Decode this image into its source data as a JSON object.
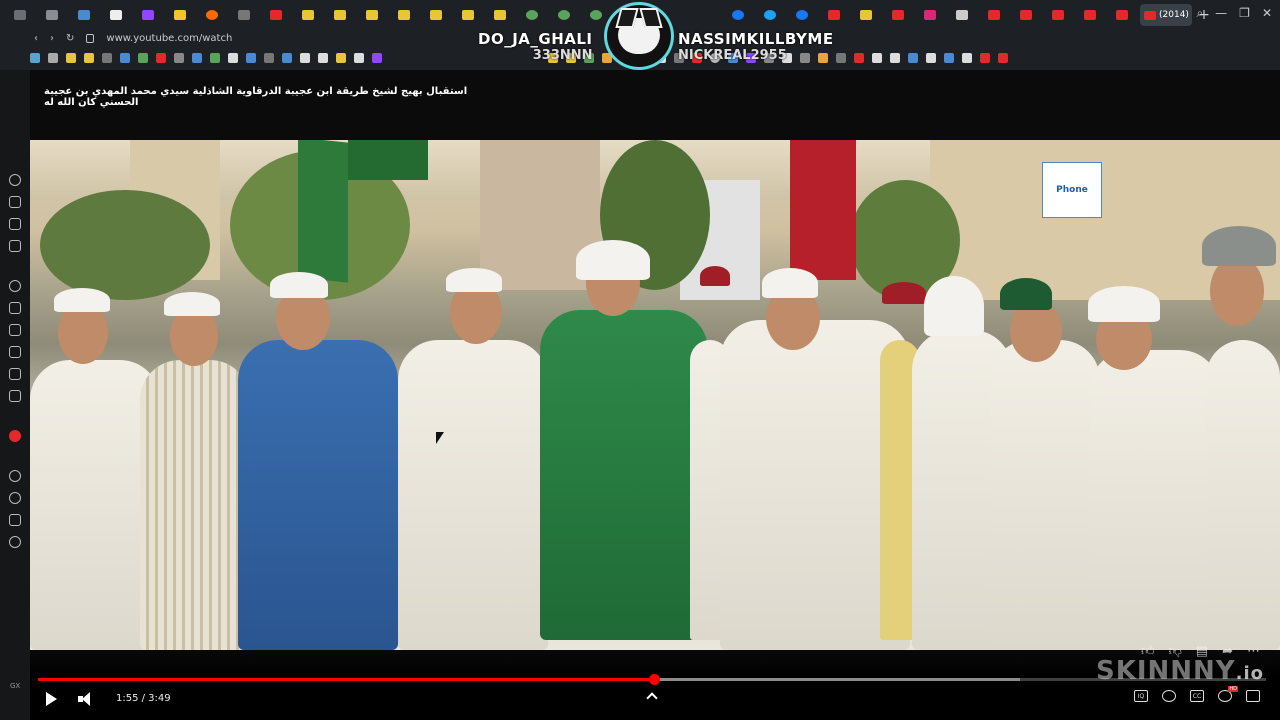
{
  "browser": {
    "active_tab_label": "(2014)",
    "new_tab_symbol": "+",
    "url": "www.youtube.com/watch"
  },
  "overlay": {
    "left_main": "DO_JA_GHALI",
    "left_sub": "333NNN",
    "right_main": "NASSIMKILLBYME",
    "right_sub": "NICKREAL2955"
  },
  "sidepanel": {
    "bottom_label": "GX"
  },
  "video": {
    "title": "استقبال بهيج لشيخ طريقة ابن عجيبة الدرقاوية الشاذلية سيدي محمد المهدي بن عجيبة الحسني كان الله له",
    "sign_text": "Phone"
  },
  "player": {
    "time": "1:55 / 3:49",
    "progress_fraction": 0.502,
    "buffer_fraction": 0.8,
    "cc_label": "CC",
    "iq_label": "IQ"
  },
  "watermark": {
    "brand": "SKINNNY",
    "tld": ".io"
  },
  "colors": {
    "progress": "#ff0000",
    "logo_ring": "#5fd8e0"
  }
}
